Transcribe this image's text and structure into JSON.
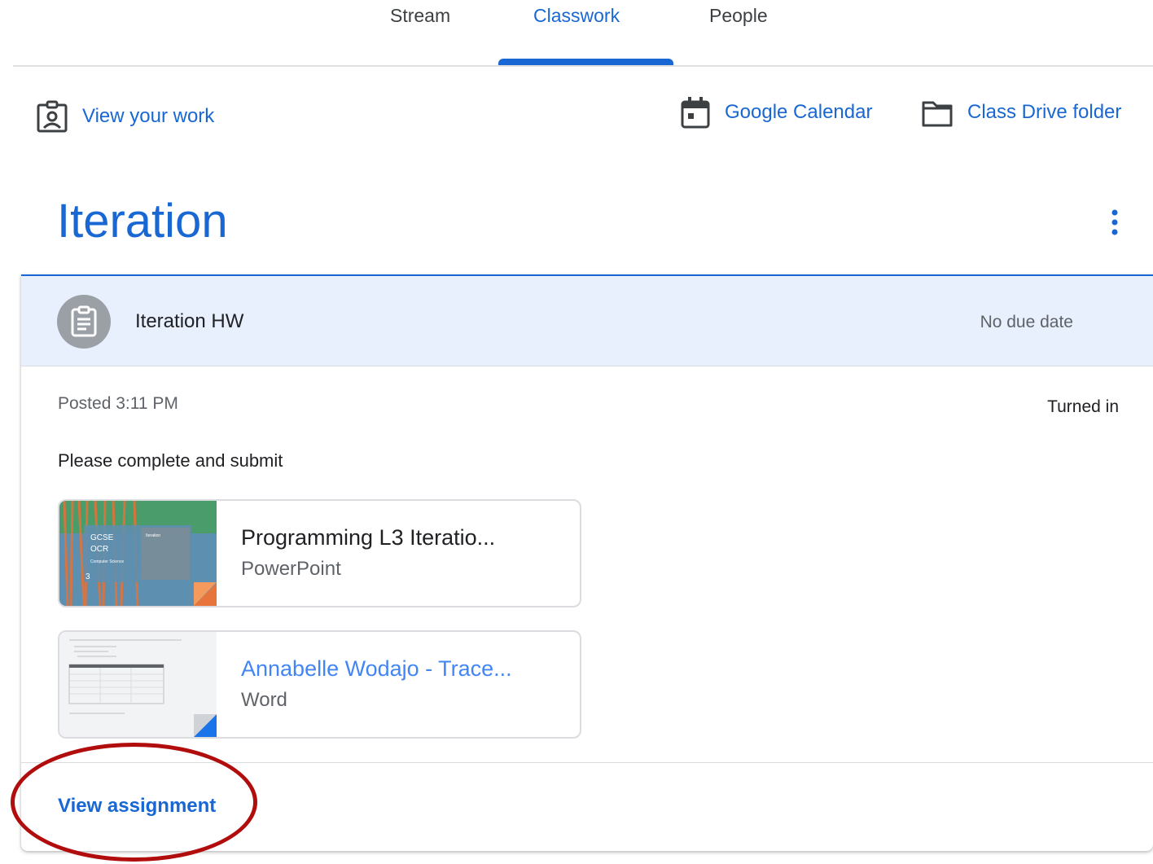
{
  "tabs": [
    {
      "label": "Stream",
      "active": false
    },
    {
      "label": "Classwork",
      "active": true
    },
    {
      "label": "People",
      "active": false
    }
  ],
  "actions": {
    "view_work": "View your work",
    "calendar": "Google Calendar",
    "drive": "Class Drive folder"
  },
  "topic": {
    "title": "Iteration"
  },
  "assignment": {
    "title": "Iteration HW",
    "due": "No due date",
    "posted": "Posted 3:11 PM",
    "status": "Turned in",
    "instructions": "Please complete and submit",
    "attachments": [
      {
        "name": "Programming L3 Iteratio...",
        "type": "PowerPoint",
        "thumb_lines": [
          "GCSE",
          "OCR",
          "Computer Science",
          "3",
          "Iteration"
        ]
      },
      {
        "name": "Annabelle Wodajo - Trace...",
        "type": "Word"
      }
    ],
    "view_link": "View assignment"
  },
  "colors": {
    "accent": "#1967d2",
    "header_bg": "#e8f0fe",
    "annotation": "#b10d0d"
  },
  "icons": {
    "view_work": "assignment-ind-icon",
    "calendar": "calendar-icon",
    "drive": "folder-icon",
    "more": "more-vert-icon",
    "assignment": "assignment-icon"
  }
}
